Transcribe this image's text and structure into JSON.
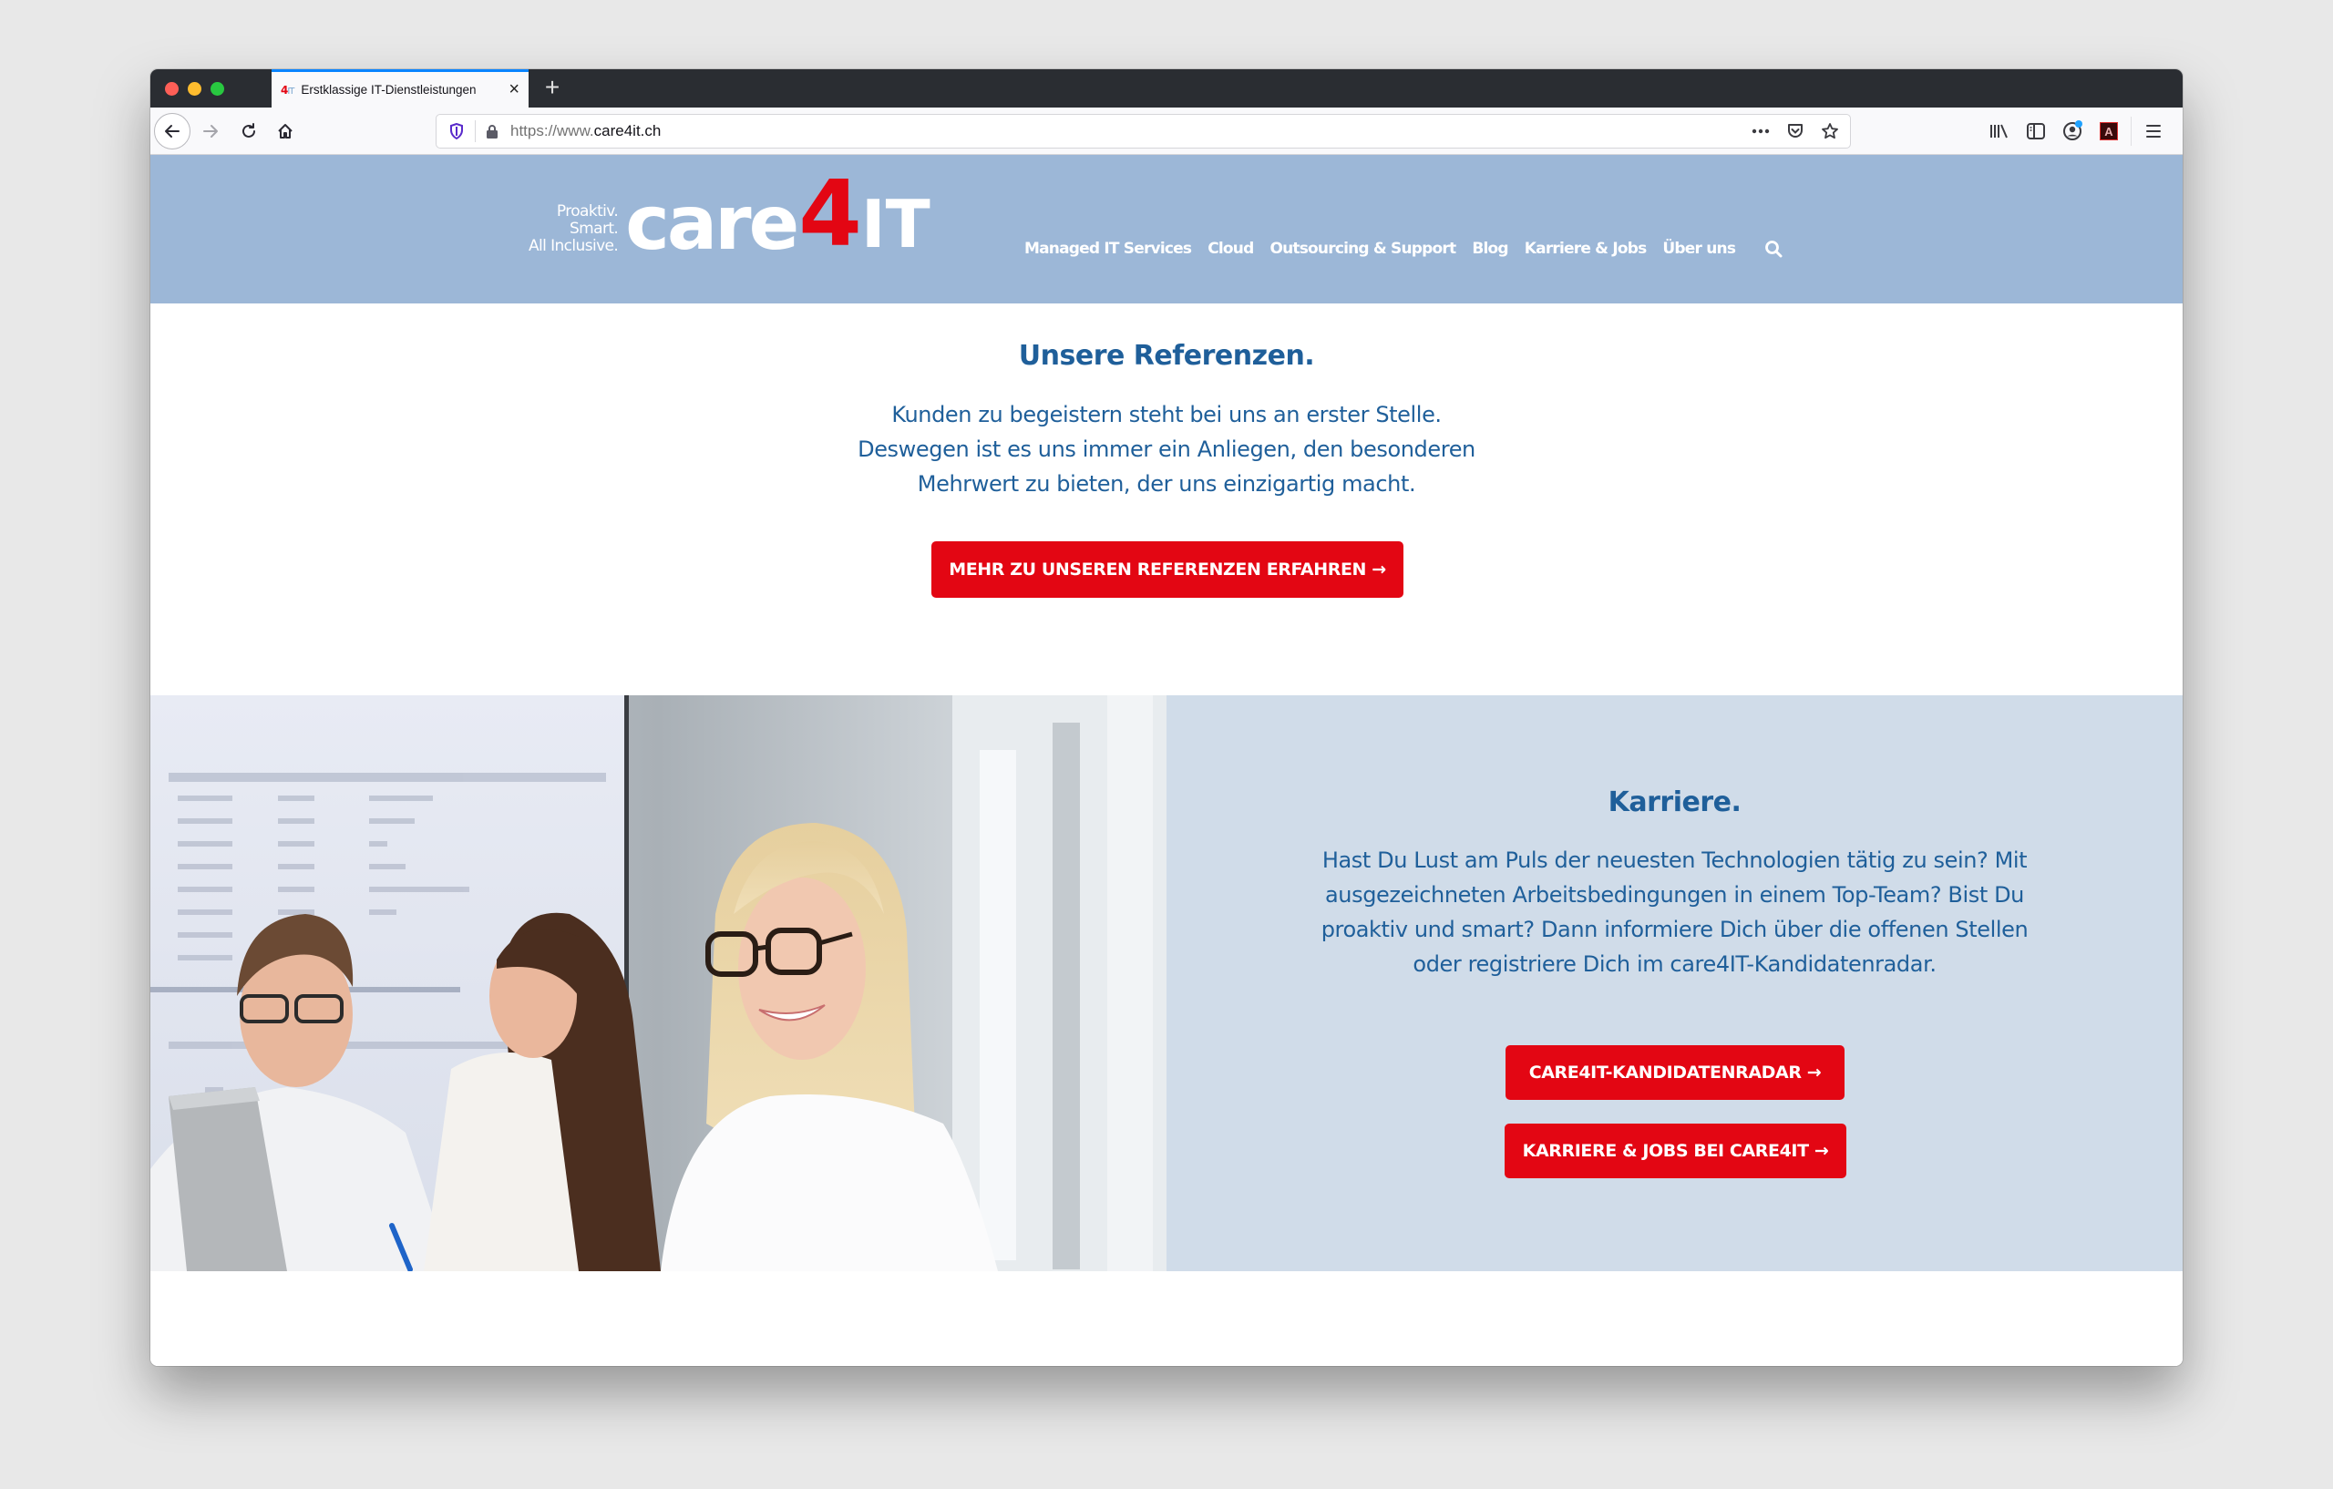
{
  "browser": {
    "tab": {
      "favicon_four": "4",
      "favicon_it": "IT",
      "title": "Erstklassige IT-Dienstleistungen",
      "close_glyph": "×"
    },
    "new_tab_glyph": "+",
    "url": {
      "prefix": "https://www.",
      "domain": "care4it.ch"
    },
    "url_actions": [
      "page-actions-icon",
      "pocket-icon",
      "bookmark-star-icon"
    ],
    "right_tools": [
      "library-icon",
      "sidebar-icon",
      "account-icon",
      "acrobat-icon",
      "menu-icon"
    ],
    "acrobat_glyph": "A"
  },
  "site": {
    "logo": {
      "tagline": [
        "Proaktiv.",
        "Smart.",
        "All Inclusive."
      ],
      "word": "care",
      "four": "4",
      "it": "IT"
    },
    "nav": [
      "Managed IT Services",
      "Cloud",
      "Outsourcing & Support",
      "Blog",
      "Karriere & Jobs",
      "Über uns"
    ],
    "colors": {
      "header_bg": "#9cb7d7",
      "brand_red": "#e30613",
      "text_blue": "#1f5f9a",
      "panel_bg": "#d0dce9"
    }
  },
  "references": {
    "title": "Unsere Referenzen.",
    "body": [
      "Kunden zu begeistern steht bei uns an erster Stelle.",
      "Deswegen ist es uns immer ein Anliegen, den besonderen",
      "Mehrwert zu bieten, der uns einzigartig macht."
    ],
    "cta": "MEHR ZU UNSEREN REFERENZEN ERFAHREN →"
  },
  "career": {
    "title": "Karriere.",
    "body": [
      "Hast Du Lust am Puls der neuesten Technologien tätig zu sein? Mit",
      "ausgezeichneten Arbeitsbedingungen in einem Top-Team? Bist Du",
      "proaktiv und smart? Dann informiere Dich über die offenen Stellen",
      "oder registriere Dich im care4IT-Kandidatenradar."
    ],
    "cta_primary": "CARE4IT-KANDIDATENRADAR →",
    "cta_secondary": "KARRIERE & JOBS BEI CARE4IT →",
    "photo_alt": "Drei lächelnde Mitarbeitende am Besprechungstisch vor einem Bildschirm"
  }
}
